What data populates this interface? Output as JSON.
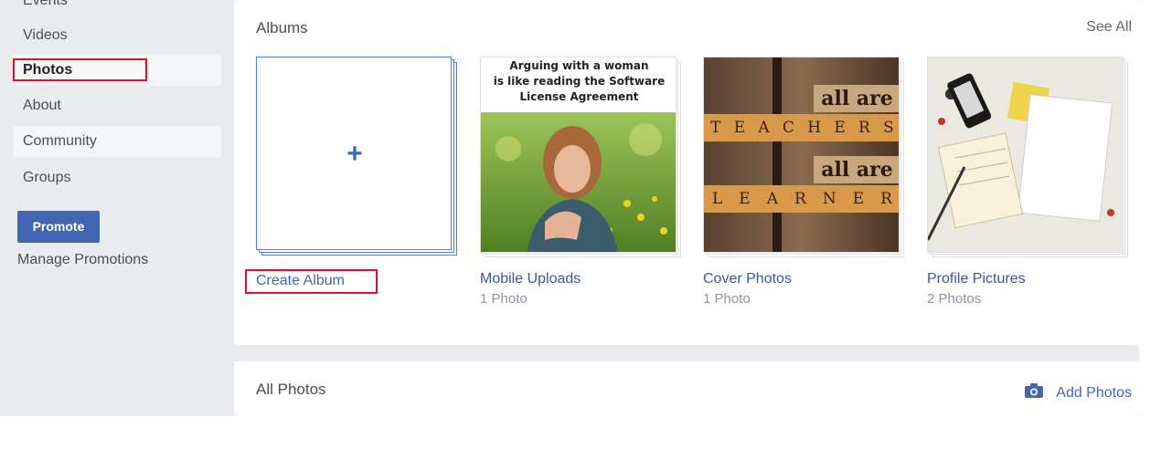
{
  "sidebar": {
    "items": [
      {
        "label": "Events"
      },
      {
        "label": "Videos"
      },
      {
        "label": "Photos"
      },
      {
        "label": "About"
      },
      {
        "label": "Community"
      },
      {
        "label": "Groups"
      }
    ],
    "promote_label": "Promote",
    "manage_label": "Manage Promotions"
  },
  "albums": {
    "title": "Albums",
    "see_all": "See All",
    "create_label": "Create Album",
    "items": [
      {
        "name": "Mobile Uploads",
        "count": "1 Photo",
        "caption": [
          "Arguing with a woman",
          "is like reading the Software",
          "License Agreement"
        ]
      },
      {
        "name": "Cover Photos",
        "count": "1 Photo",
        "tiles_top": "all are",
        "word1": [
          "T",
          "E",
          "A",
          "C",
          "H",
          "E",
          "R",
          "S"
        ],
        "tiles_mid": "all are",
        "word2": [
          "L",
          "E",
          "A",
          "R",
          "N",
          "E",
          "R"
        ]
      },
      {
        "name": "Profile Pictures",
        "count": "2 Photos"
      }
    ]
  },
  "all_photos": {
    "title": "All Photos",
    "add_label": "Add Photos"
  },
  "colors": {
    "accent": "#4267b2",
    "highlight_box": "#e0102a",
    "page_bg": "#e9ebee"
  }
}
